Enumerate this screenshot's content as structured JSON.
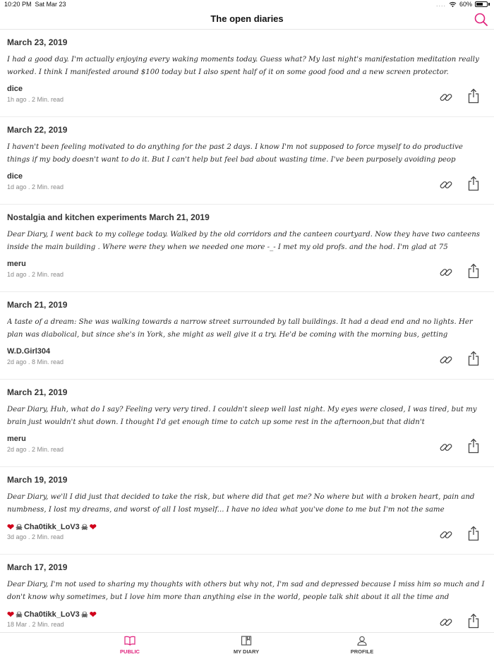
{
  "status_bar": {
    "time": "10:20 PM",
    "date": "Sat Mar 23",
    "battery": "60%"
  },
  "nav": {
    "title": "The open diaries"
  },
  "entries": [
    {
      "title": "March 23, 2019",
      "body": "I had a good day. I'm actually enjoying every waking moments today. Guess what? My last night's manifestation meditation really worked. I think I manifested around $100 today but I also spent half of it on some good food and a new screen protector.",
      "author": "dice",
      "meta": "1h ago . 2 Min. read"
    },
    {
      "title": "March 22, 2019",
      "body": "I haven't been feeling motivated to do anything for the past 2 days. I know I'm not supposed to force myself to do productive things if my body doesn't want to do it. But I can't help but feel bad about wasting time. I've been purposely avoiding peop",
      "author": "dice",
      "meta": "1d ago . 2 Min. read"
    },
    {
      "title": "Nostalgia and kitchen experiments March 21, 2019",
      "body": "Dear Diary, I went back to my college today. Walked by the old corridors and the canteen courtyard. Now they have two canteens inside the main building . Where were they when we needed one more -_- I met my old profs.  and the hod. I'm glad at 75",
      "author": "meru",
      "meta": "1d ago . 2 Min. read"
    },
    {
      "title": "March 21, 2019",
      "body": "A taste of a dream: She was walking towards a narrow street surrounded by tall buildings. It had a dead end and no lights. Her plan was diabolical, but since she's in York, she might as well give it a try. He'd be coming with the morning bus, getting",
      "author": "W.D.Girl304",
      "meta": "2d ago . 8 Min. read"
    },
    {
      "title": "March 21, 2019",
      "body": "Dear Diary, Huh, what do I say? Feeling very very tired. I couldn't sleep well last night. My eyes were closed, I was tired, but my brain just wouldn't shut down. I thought I'd get enough time to catch up some rest in the afternoon,but that didn't",
      "author": "meru",
      "meta": "2d ago . 2 Min. read"
    },
    {
      "title": "March 19, 2019",
      "body": "Dear Diary, we'll I did just that decided to take the risk, but where did that get me? No where but with a broken heart, pain and numbness, I lost my dreams, and worst of all I lost myself... I have no idea what you've done to me but I'm not the same",
      "author": "Cha0tikk_LoV3",
      "author_decorated": true,
      "meta": "3d ago . 2 Min. read"
    },
    {
      "title": "March 17, 2019",
      "body": "Dear Diary, I'm not used to sharing my thoughts with others but why not, I'm sad and depressed because I miss him so much and I don't know why sometimes, but I love him more than anything else in the world, people talk shit about it all the time and",
      "author": "Cha0tikk_LoV3",
      "author_decorated": true,
      "meta": "18 Mar . 2 Min. read"
    }
  ],
  "tabs": [
    {
      "label": "PUBLIC",
      "icon": "book-open-icon",
      "active": true
    },
    {
      "label": "MY DIARY",
      "icon": "diary-icon",
      "active": false
    },
    {
      "label": "PROFILE",
      "icon": "user-icon",
      "active": false
    }
  ],
  "colors": {
    "accent": "#e0217c",
    "heart": "#d0021b"
  }
}
